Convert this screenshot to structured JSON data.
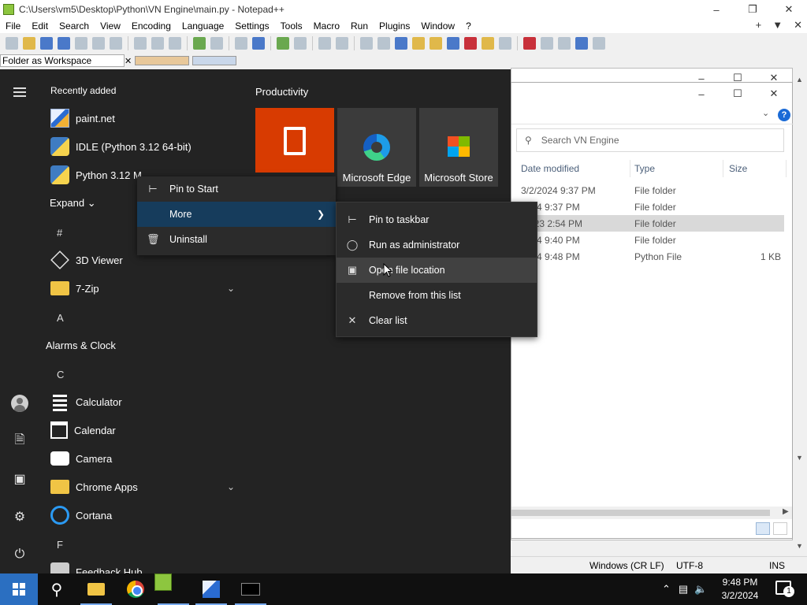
{
  "notepad": {
    "title": "C:\\Users\\vm5\\Desktop\\Python\\VN Engine\\main.py - Notepad++",
    "menu": [
      "File",
      "Edit",
      "Search",
      "View",
      "Encoding",
      "Language",
      "Settings",
      "Tools",
      "Macro",
      "Run",
      "Plugins",
      "Window",
      "?"
    ],
    "menu_right": [
      "+",
      "▼",
      "✕"
    ],
    "panel_label": "Folder as Workspace",
    "status": {
      "eol": "Windows (CR LF)",
      "encoding": "UTF-8",
      "mode": "INS"
    }
  },
  "explorer": {
    "search_placeholder": "Search VN Engine",
    "columns": [
      "Date modified",
      "Type",
      "Size"
    ],
    "rows": [
      {
        "date": "3/2/2024 9:37 PM",
        "type": "File folder",
        "size": ""
      },
      {
        "date": "2024 9:37 PM",
        "type": "File folder",
        "size": ""
      },
      {
        "date": "/2023 2:54 PM",
        "type": "File folder",
        "size": ""
      },
      {
        "date": "2024 9:40 PM",
        "type": "File folder",
        "size": ""
      },
      {
        "date": "2024 9:48 PM",
        "type": "Python File",
        "size": "1 KB"
      }
    ],
    "help": "?"
  },
  "start_menu": {
    "recently_added_header": "Recently added",
    "recent": [
      "paint.net",
      "IDLE (Python 3.12 64-bit)",
      "Python 3.12 M..."
    ],
    "expand_label": "Expand",
    "groups": [
      {
        "letter": "#",
        "apps": [
          {
            "name": "3D Viewer"
          },
          {
            "name": "7-Zip"
          }
        ]
      },
      {
        "letter": "A",
        "apps": [
          {
            "name": "Alarms & Clock"
          }
        ]
      },
      {
        "letter": "C",
        "apps": [
          {
            "name": "Calculator"
          },
          {
            "name": "Calendar"
          },
          {
            "name": "Camera"
          },
          {
            "name": "Chrome Apps"
          },
          {
            "name": "Cortana"
          }
        ]
      },
      {
        "letter": "F",
        "apps": [
          {
            "name": "Feedback Hub"
          }
        ]
      }
    ],
    "productivity_header": "Productivity",
    "tiles": [
      "Microsoft Edge",
      "Microsoft Store"
    ]
  },
  "context_menu": {
    "items": [
      "Pin to Start",
      "More",
      "Uninstall"
    ]
  },
  "submenu": {
    "items": [
      "Pin to taskbar",
      "Run as administrator",
      "Open file location",
      "Remove from this list",
      "Clear list"
    ]
  },
  "taskbar": {
    "time": "9:48 PM",
    "date": "3/2/2024",
    "notification_count": "1"
  }
}
